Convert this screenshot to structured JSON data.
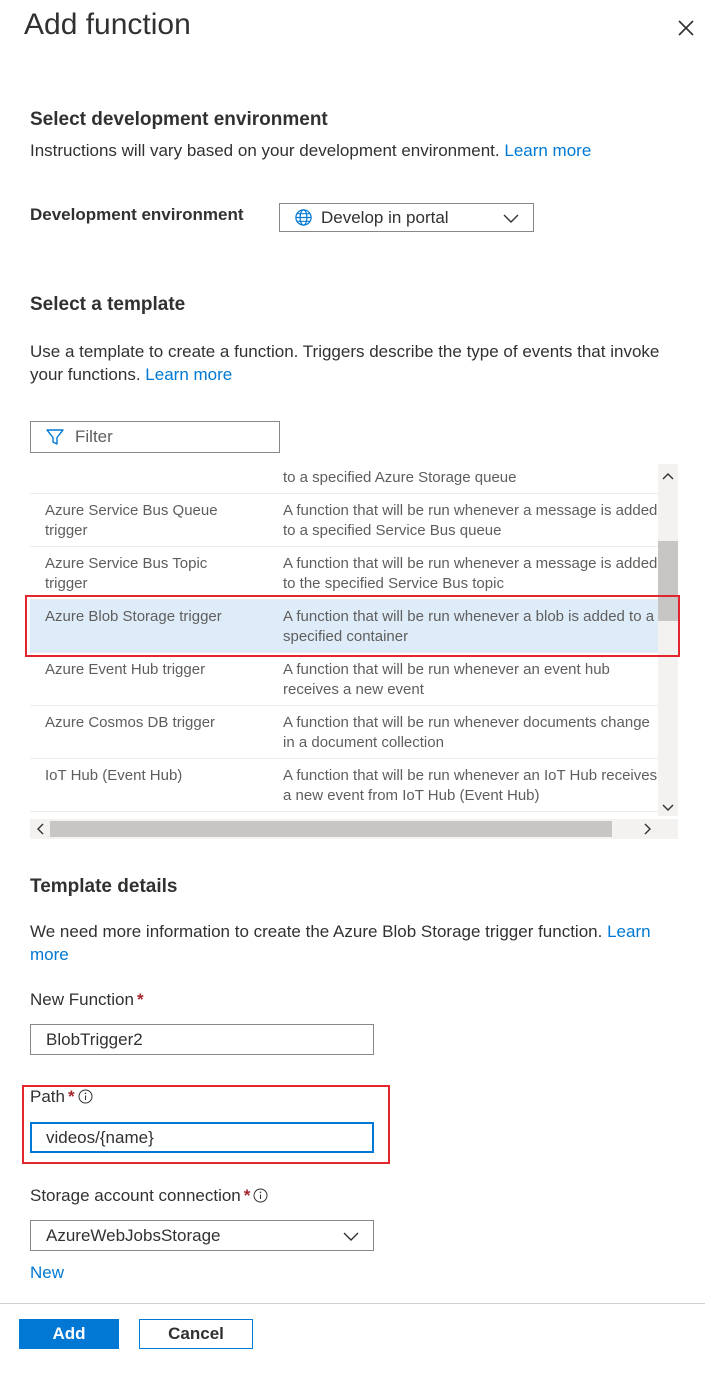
{
  "panel": {
    "title": "Add function"
  },
  "env_section": {
    "heading": "Select development environment",
    "description": "Instructions will vary based on your development environment.",
    "learn_more": "Learn more",
    "field_label": "Development environment",
    "selected_value": "Develop in portal"
  },
  "template_section": {
    "heading": "Select a template",
    "description": "Use a template to create a function. Triggers describe the type of events that invoke your functions.",
    "learn_more": "Learn more",
    "filter_placeholder": "Filter",
    "rows": [
      {
        "name": "",
        "description": "to a specified Azure Storage queue"
      },
      {
        "name": "Azure Service Bus Queue trigger",
        "description": "A function that will be run whenever a message is added to a specified Service Bus queue"
      },
      {
        "name": "Azure Service Bus Topic trigger",
        "description": "A function that will be run whenever a message is added to the specified Service Bus topic"
      },
      {
        "name": "Azure Blob Storage trigger",
        "description": "A function that will be run whenever a blob is added to a specified container"
      },
      {
        "name": "Azure Event Hub trigger",
        "description": "A function that will be run whenever an event hub receives a new event"
      },
      {
        "name": "Azure Cosmos DB trigger",
        "description": "A function that will be run whenever documents change in a document collection"
      },
      {
        "name": "IoT Hub (Event Hub)",
        "description": "A function that will be run whenever an IoT Hub receives a new event from IoT Hub (Event Hub)"
      }
    ],
    "selected_row": "Azure Blob Storage trigger"
  },
  "template_details": {
    "heading": "Template details",
    "description": "We need more information to create the Azure Blob Storage trigger function.",
    "learn_more": "Learn more",
    "new_function_label": "New Function",
    "new_function_value": "BlobTrigger2",
    "path_label": "Path",
    "path_value": "videos/{name}",
    "storage_label": "Storage account connection",
    "storage_value": "AzureWebJobsStorage",
    "new_link": "New",
    "required_marker": "*"
  },
  "footer": {
    "add_label": "Add",
    "cancel_label": "Cancel"
  },
  "colors": {
    "accent": "#0078d4",
    "selected_row": "#deecf9",
    "required": "#a4262c",
    "highlight_box": "#e3262d"
  },
  "icons": {
    "close": "close-icon",
    "globe": "globe-icon",
    "filter": "filter-icon",
    "chevron": "chevron-down-icon",
    "info": "info-icon"
  }
}
